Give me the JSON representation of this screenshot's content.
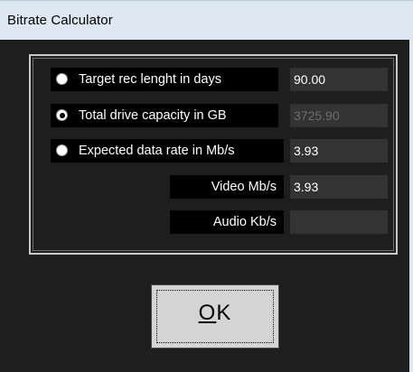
{
  "window": {
    "title": "Bitrate Calculator"
  },
  "options": [
    {
      "label": "Target rec lenght in days",
      "value": "90.00",
      "checked": false,
      "disabled": false
    },
    {
      "label": "Total drive capacity in GB",
      "value": "3725.90",
      "checked": true,
      "disabled": true
    },
    {
      "label": "Expected data rate in Mb/s",
      "value": "3.93",
      "checked": false,
      "disabled": false
    }
  ],
  "breakdown": [
    {
      "label": "Video Mb/s",
      "value": "3.93"
    },
    {
      "label": "Audio Kb/s",
      "value": ""
    }
  ],
  "ok_button": {
    "mnemonic": "O",
    "rest": "K"
  },
  "colors": {
    "background": "#1e1e1e",
    "label_bg": "#000000",
    "field_bg": "#333333",
    "titlebar": "#dde8f3"
  }
}
